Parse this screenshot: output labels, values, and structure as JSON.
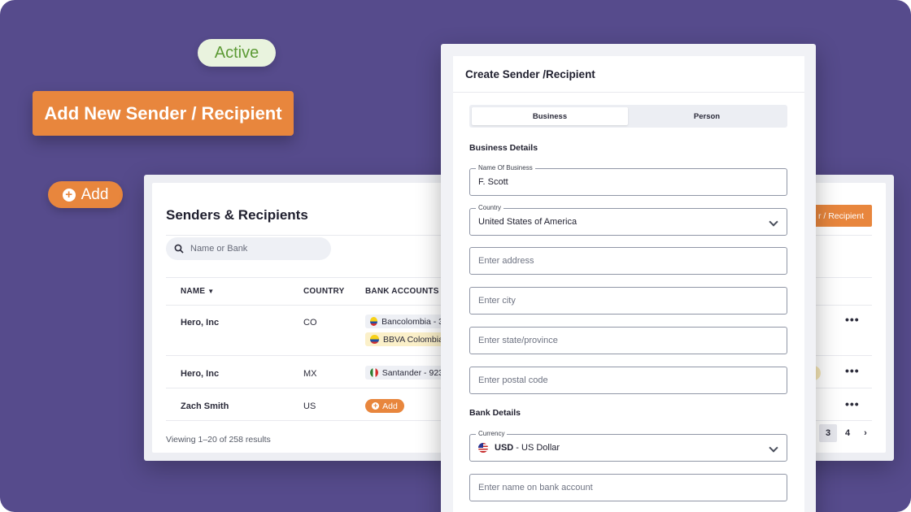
{
  "badges": {
    "active": "Active"
  },
  "buttons": {
    "add_new": "Add New Sender / Recipient",
    "add": "Add"
  },
  "table_panel": {
    "title": "Senders & Recipients",
    "search_placeholder": "Name or Bank",
    "columns": {
      "name": "NAME",
      "country": "COUNTRY",
      "bank_accounts": "BANK ACCOUNTS"
    },
    "rows": [
      {
        "name": "Hero, Inc",
        "country": "CO",
        "banks": [
          "Bancolombia - 3",
          "BBVA Colombia"
        ]
      },
      {
        "name": "Hero, Inc",
        "country": "MX",
        "banks": [
          "Santander - 923"
        ]
      },
      {
        "name": "Zach Smith",
        "country": "US",
        "add_label": "Add"
      }
    ],
    "footer": "Viewing 1–20 of 258 results",
    "peek_button": "r / Recipient",
    "pagination": [
      "3",
      "4"
    ]
  },
  "form": {
    "title": "Create Sender /Recipient",
    "tabs": [
      "Business",
      "Person"
    ],
    "active_tab": "Business",
    "business_details_heading": "Business Details",
    "fields": {
      "business_name": {
        "label": "Name Of Business",
        "value": "F. Scott"
      },
      "country": {
        "label": "Country",
        "value": "United States of America"
      },
      "address_placeholder": "Enter address",
      "city_placeholder": "Enter city",
      "state_placeholder": "Enter state/province",
      "postal_placeholder": "Enter postal code",
      "currency": {
        "label": "Currency",
        "code": "USD",
        "name": " - US Dollar"
      },
      "bank_name_placeholder": "Enter name on bank account"
    },
    "bank_details_heading": "Bank Details"
  },
  "colors": {
    "background": "#564b8c",
    "accent_orange": "#e8863d",
    "active_green": "#5c9a35",
    "active_bg": "#e9f3de"
  }
}
